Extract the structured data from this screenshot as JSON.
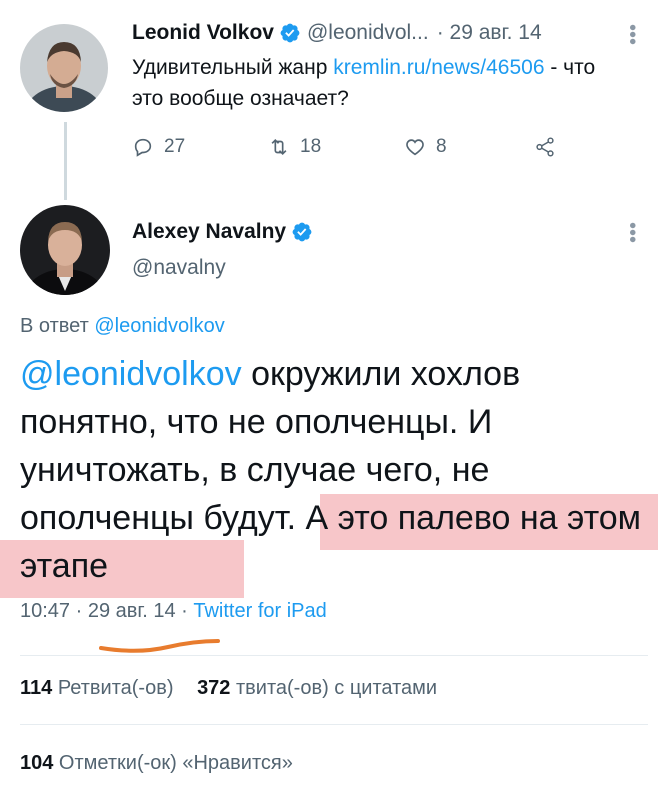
{
  "tweet1": {
    "name": "Leonid Volkov",
    "handle": "@leonidvol...",
    "date": "· 29 авг. 14",
    "text_before": "Удивительный жанр ",
    "link": "kremlin.ru/news/46506",
    "text_after": " - что это вообще означает?",
    "replies": "27",
    "retweets": "18",
    "likes": "8"
  },
  "tweet2": {
    "name": "Alexey Navalny",
    "handle": "@navalny",
    "reply_label": "В ответ ",
    "reply_handle": "@leonidvolkov",
    "mention": "@leonidvolkov",
    "text_plain": " окружили хохлов понятно, что не ополченцы. И уничтожать, в случае чего, не ополченцы будут.",
    "text_highlighted": " А это палево на этом этапе",
    "time": "10:47 · 29 авг. 14 · ",
    "source": "Twitter for iPad",
    "retweets_count": "114",
    "retweets_label": " Ретвита(-ов)",
    "quotes_count": "372",
    "quotes_label": " твита(-ов) с цитатами",
    "likes_count": "104",
    "likes_label": " Отметки(-ок) «Нравится»"
  },
  "colors": {
    "link": "#1d9bf0",
    "highlight": "#f7c6c9",
    "annotation_underline": "#e87c2e"
  },
  "icons": [
    "verified-badge-icon",
    "reply-icon",
    "retweet-icon",
    "like-icon",
    "share-icon",
    "more-icon"
  ]
}
